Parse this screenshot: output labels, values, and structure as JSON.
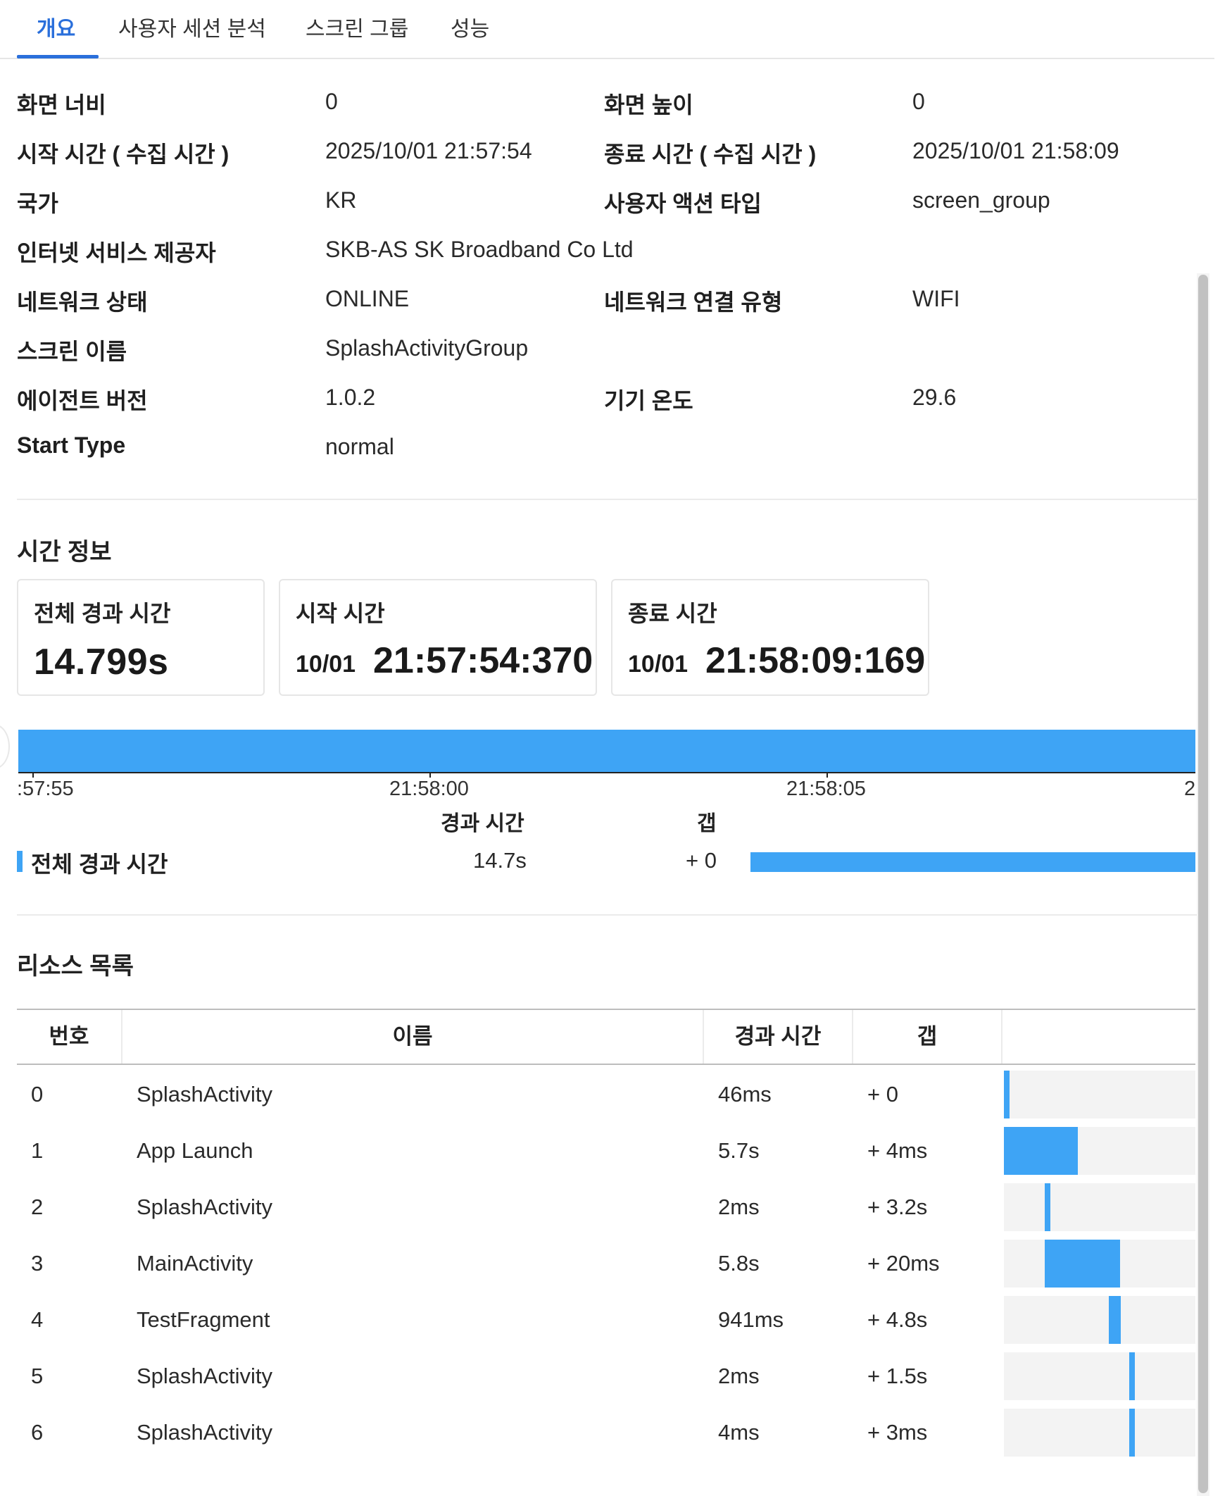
{
  "tabs": [
    {
      "label": "개요",
      "active": true
    },
    {
      "label": "사용자 세션 분석",
      "active": false
    },
    {
      "label": "스크린 그룹",
      "active": false
    },
    {
      "label": "성능",
      "active": false
    }
  ],
  "info": {
    "screen_width_label": "화면 너비",
    "screen_width_value": "0",
    "screen_height_label": "화면 높이",
    "screen_height_value": "0",
    "start_time_label": "시작 시간 ( 수집 시간 )",
    "start_time_value": "2025/10/01 21:57:54",
    "end_time_label": "종료 시간 ( 수집 시간 )",
    "end_time_value": "2025/10/01 21:58:09",
    "country_label": "국가",
    "country_value": "KR",
    "action_type_label": "사용자 액션 타입",
    "action_type_value": "screen_group",
    "isp_label": "인터넷 서비스 제공자",
    "isp_value": "SKB-AS SK Broadband Co Ltd",
    "network_state_label": "네트워크 상태",
    "network_state_value": "ONLINE",
    "network_type_label": "네트워크 연결 유형",
    "network_type_value": "WIFI",
    "screen_name_label": "스크린 이름",
    "screen_name_value": "SplashActivityGroup",
    "agent_version_label": "에이전트 버전",
    "agent_version_value": "1.0.2",
    "device_temp_label": "기기 온도",
    "device_temp_value": "29.6",
    "start_type_label": "Start Type",
    "start_type_value": "normal"
  },
  "time_info": {
    "section_title": "시간 정보",
    "total_label": "전체 경과 시간",
    "total_value": "14.799s",
    "start_label": "시작 시간",
    "start_date": "10/01",
    "start_time": "21:57:54:370",
    "end_label": "종료 시간",
    "end_date": "10/01",
    "end_time": "21:58:09:169"
  },
  "timeline": {
    "ticks": [
      ":57:55",
      "21:58:00",
      "21:58:05",
      "2"
    ],
    "col_elapsed": "경과 시간",
    "col_gap": "갭",
    "row_label": "전체 경과 시간",
    "row_elapsed": "14.7s",
    "row_gap": "+ 0"
  },
  "resources": {
    "section_title": "리소스 목록",
    "columns": [
      "번호",
      "이름",
      "경과 시간",
      "갭"
    ],
    "rows": [
      {
        "no": "0",
        "name": "SplashActivity",
        "elapsed": "46ms",
        "gap": "+ 0",
        "start_frac": 0.0,
        "width_frac": 0.031
      },
      {
        "no": "1",
        "name": "App Launch",
        "elapsed": "5.7s",
        "gap": "+ 4ms",
        "start_frac": 0.0,
        "width_frac": 0.386
      },
      {
        "no": "2",
        "name": "SplashActivity",
        "elapsed": "2ms",
        "gap": "+ 3.2s",
        "start_frac": 0.215,
        "width_frac": 0.031
      },
      {
        "no": "3",
        "name": "MainActivity",
        "elapsed": "5.8s",
        "gap": "+ 20ms",
        "start_frac": 0.215,
        "width_frac": 0.393
      },
      {
        "no": "4",
        "name": "TestFragment",
        "elapsed": "941ms",
        "gap": "+ 4.8s",
        "start_frac": 0.547,
        "width_frac": 0.064
      },
      {
        "no": "5",
        "name": "SplashActivity",
        "elapsed": "2ms",
        "gap": "+ 1.5s",
        "start_frac": 0.655,
        "width_frac": 0.031
      },
      {
        "no": "6",
        "name": "SplashActivity",
        "elapsed": "4ms",
        "gap": "+ 3ms",
        "start_frac": 0.655,
        "width_frac": 0.031
      }
    ]
  },
  "colors": {
    "accent": "#2a6fdb",
    "bar": "#3ea4f5",
    "track": "#f3f3f3"
  }
}
